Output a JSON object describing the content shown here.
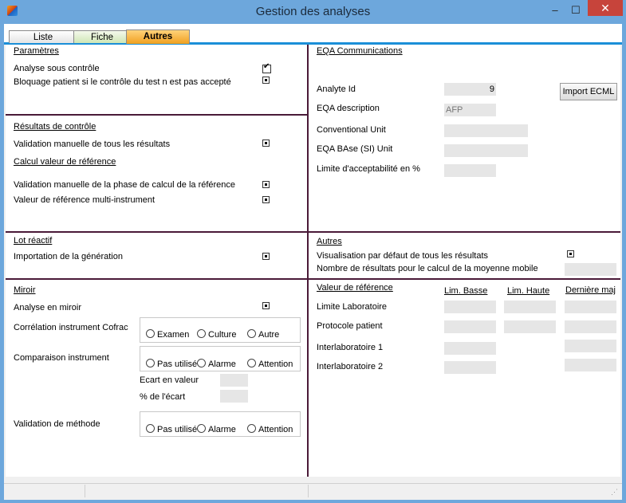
{
  "window": {
    "title": "Gestion des analyses",
    "min": "–",
    "max": "☐",
    "close": "✕"
  },
  "tabs": [
    {
      "label": "Liste"
    },
    {
      "label": "Fiche"
    },
    {
      "label": "Autres"
    }
  ],
  "parametres": {
    "title": "Paramètres",
    "analyse_sous_controle": "Analyse sous contrôle",
    "bloquage": "Bloquage patient si le contrôle du test n est pas  accepté"
  },
  "resultats": {
    "title": "Résultats de contrôle",
    "validation_manuelle": "Validation manuelle de tous les résultats",
    "calcul_title": "Calcul valeur de référence",
    "validation_phase": "Validation manuelle de la  phase de calcul de la référence",
    "valeur_multi": "Valeur de référence multi-instrument"
  },
  "lot": {
    "title": "Lot réactif",
    "importation": "Importation de la génération"
  },
  "miroir": {
    "title": "Miroir",
    "analyse_miroir": "Analyse en miroir",
    "correlation_label": "Corrélation instrument Cofrac",
    "correlation_options": [
      "Examen",
      "Culture",
      "Autre"
    ],
    "comparaison_label": "Comparaison instrument",
    "comparaison_options": [
      "Pas utilisé",
      "Alarme",
      "Attention"
    ],
    "ecart_valeur": "Ecart en valeur",
    "pct_ecart": "% de l'écart",
    "validation_label": "Validation de méthode",
    "validation_options": [
      "Pas utilisé",
      "Alarme",
      "Attention"
    ]
  },
  "eqa": {
    "title": "EQA Communications",
    "analyte_id_label": "Analyte Id",
    "analyte_id_value": "9",
    "description_label": "EQA description",
    "description_value": "AFP",
    "conventional_label": "Conventional  Unit",
    "base_label": "EQA BAse (SI) Unit",
    "limite_label": "Limite d'acceptabilité en %",
    "import_button": "Import ECML"
  },
  "autres": {
    "title": "Autres",
    "visualisation": "Visualisation  par défaut de tous les résultats",
    "nombre": "Nombre de résultats pour le calcul de la moyenne mobile"
  },
  "valeur_ref": {
    "title": "Valeur de référence",
    "col_basse": "Lim. Basse",
    "col_haute": "Lim. Haute",
    "col_maj": "Dernière maj",
    "rows": [
      "Limite Laboratoire",
      "Protocole patient",
      "Interlaboratoire 1",
      "Interlaboratoire 2"
    ]
  }
}
